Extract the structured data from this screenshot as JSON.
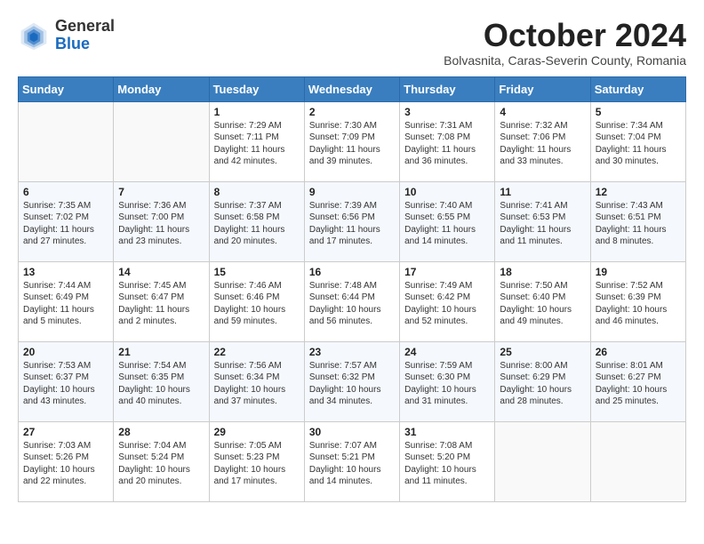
{
  "header": {
    "logo_general": "General",
    "logo_blue": "Blue",
    "month_title": "October 2024",
    "subtitle": "Bolvasnita, Caras-Severin County, Romania"
  },
  "calendar": {
    "days_of_week": [
      "Sunday",
      "Monday",
      "Tuesday",
      "Wednesday",
      "Thursday",
      "Friday",
      "Saturday"
    ],
    "weeks": [
      [
        {
          "day": "",
          "content": ""
        },
        {
          "day": "",
          "content": ""
        },
        {
          "day": "1",
          "content": "Sunrise: 7:29 AM\nSunset: 7:11 PM\nDaylight: 11 hours and 42 minutes."
        },
        {
          "day": "2",
          "content": "Sunrise: 7:30 AM\nSunset: 7:09 PM\nDaylight: 11 hours and 39 minutes."
        },
        {
          "day": "3",
          "content": "Sunrise: 7:31 AM\nSunset: 7:08 PM\nDaylight: 11 hours and 36 minutes."
        },
        {
          "day": "4",
          "content": "Sunrise: 7:32 AM\nSunset: 7:06 PM\nDaylight: 11 hours and 33 minutes."
        },
        {
          "day": "5",
          "content": "Sunrise: 7:34 AM\nSunset: 7:04 PM\nDaylight: 11 hours and 30 minutes."
        }
      ],
      [
        {
          "day": "6",
          "content": "Sunrise: 7:35 AM\nSunset: 7:02 PM\nDaylight: 11 hours and 27 minutes."
        },
        {
          "day": "7",
          "content": "Sunrise: 7:36 AM\nSunset: 7:00 PM\nDaylight: 11 hours and 23 minutes."
        },
        {
          "day": "8",
          "content": "Sunrise: 7:37 AM\nSunset: 6:58 PM\nDaylight: 11 hours and 20 minutes."
        },
        {
          "day": "9",
          "content": "Sunrise: 7:39 AM\nSunset: 6:56 PM\nDaylight: 11 hours and 17 minutes."
        },
        {
          "day": "10",
          "content": "Sunrise: 7:40 AM\nSunset: 6:55 PM\nDaylight: 11 hours and 14 minutes."
        },
        {
          "day": "11",
          "content": "Sunrise: 7:41 AM\nSunset: 6:53 PM\nDaylight: 11 hours and 11 minutes."
        },
        {
          "day": "12",
          "content": "Sunrise: 7:43 AM\nSunset: 6:51 PM\nDaylight: 11 hours and 8 minutes."
        }
      ],
      [
        {
          "day": "13",
          "content": "Sunrise: 7:44 AM\nSunset: 6:49 PM\nDaylight: 11 hours and 5 minutes."
        },
        {
          "day": "14",
          "content": "Sunrise: 7:45 AM\nSunset: 6:47 PM\nDaylight: 11 hours and 2 minutes."
        },
        {
          "day": "15",
          "content": "Sunrise: 7:46 AM\nSunset: 6:46 PM\nDaylight: 10 hours and 59 minutes."
        },
        {
          "day": "16",
          "content": "Sunrise: 7:48 AM\nSunset: 6:44 PM\nDaylight: 10 hours and 56 minutes."
        },
        {
          "day": "17",
          "content": "Sunrise: 7:49 AM\nSunset: 6:42 PM\nDaylight: 10 hours and 52 minutes."
        },
        {
          "day": "18",
          "content": "Sunrise: 7:50 AM\nSunset: 6:40 PM\nDaylight: 10 hours and 49 minutes."
        },
        {
          "day": "19",
          "content": "Sunrise: 7:52 AM\nSunset: 6:39 PM\nDaylight: 10 hours and 46 minutes."
        }
      ],
      [
        {
          "day": "20",
          "content": "Sunrise: 7:53 AM\nSunset: 6:37 PM\nDaylight: 10 hours and 43 minutes."
        },
        {
          "day": "21",
          "content": "Sunrise: 7:54 AM\nSunset: 6:35 PM\nDaylight: 10 hours and 40 minutes."
        },
        {
          "day": "22",
          "content": "Sunrise: 7:56 AM\nSunset: 6:34 PM\nDaylight: 10 hours and 37 minutes."
        },
        {
          "day": "23",
          "content": "Sunrise: 7:57 AM\nSunset: 6:32 PM\nDaylight: 10 hours and 34 minutes."
        },
        {
          "day": "24",
          "content": "Sunrise: 7:59 AM\nSunset: 6:30 PM\nDaylight: 10 hours and 31 minutes."
        },
        {
          "day": "25",
          "content": "Sunrise: 8:00 AM\nSunset: 6:29 PM\nDaylight: 10 hours and 28 minutes."
        },
        {
          "day": "26",
          "content": "Sunrise: 8:01 AM\nSunset: 6:27 PM\nDaylight: 10 hours and 25 minutes."
        }
      ],
      [
        {
          "day": "27",
          "content": "Sunrise: 7:03 AM\nSunset: 5:26 PM\nDaylight: 10 hours and 22 minutes."
        },
        {
          "day": "28",
          "content": "Sunrise: 7:04 AM\nSunset: 5:24 PM\nDaylight: 10 hours and 20 minutes."
        },
        {
          "day": "29",
          "content": "Sunrise: 7:05 AM\nSunset: 5:23 PM\nDaylight: 10 hours and 17 minutes."
        },
        {
          "day": "30",
          "content": "Sunrise: 7:07 AM\nSunset: 5:21 PM\nDaylight: 10 hours and 14 minutes."
        },
        {
          "day": "31",
          "content": "Sunrise: 7:08 AM\nSunset: 5:20 PM\nDaylight: 10 hours and 11 minutes."
        },
        {
          "day": "",
          "content": ""
        },
        {
          "day": "",
          "content": ""
        }
      ]
    ]
  }
}
